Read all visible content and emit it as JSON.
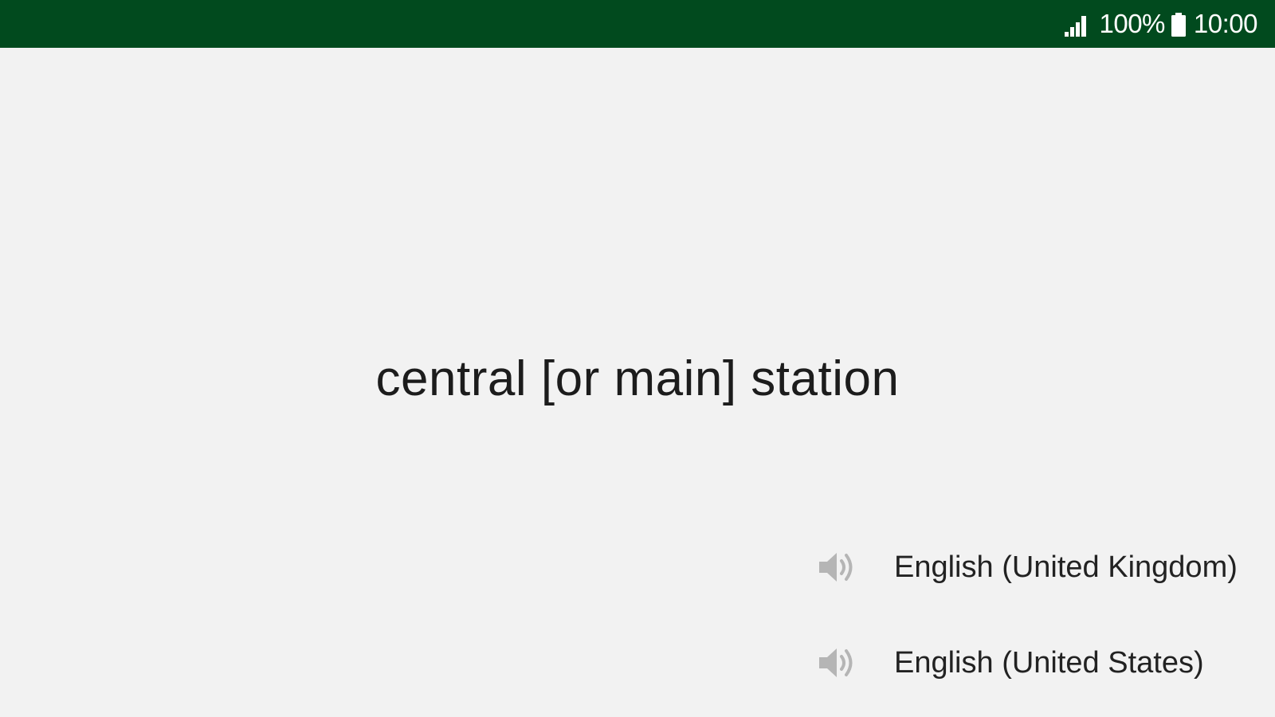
{
  "status_bar": {
    "battery_percent": "100%",
    "time": "10:00",
    "signal_icon": "signal-icon",
    "battery_icon": "battery-icon",
    "background": "#014a1e"
  },
  "main": {
    "term": "central [or main] station",
    "pronunciations": [
      {
        "label": "English (United Kingdom)",
        "icon": "speaker-icon"
      },
      {
        "label": "English (United States)",
        "icon": "speaker-icon"
      }
    ]
  }
}
